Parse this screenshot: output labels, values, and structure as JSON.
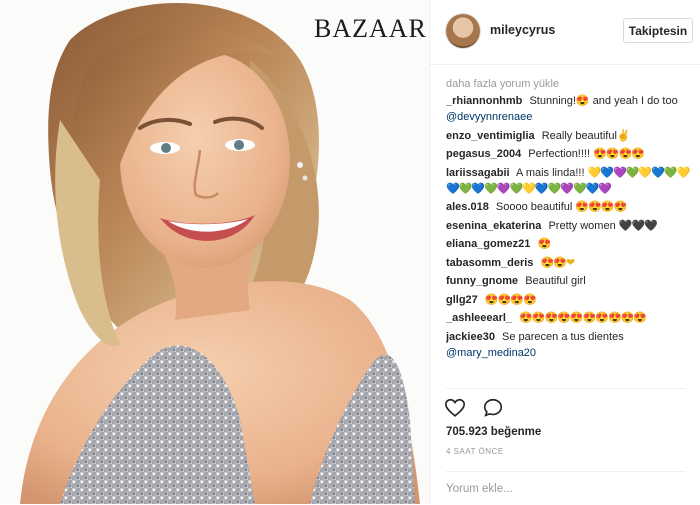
{
  "photo": {
    "brand": "BAZAAR"
  },
  "header": {
    "username": "mileycyrus",
    "follow_label": "Takiptesin"
  },
  "load_more": "daha fazla yorum yükle",
  "comments": [
    {
      "user": "_rhiannonhmb",
      "text": "Stunning!😍 and yeah I do too",
      "mention": "@devyynnrenaee"
    },
    {
      "user": "enzo_ventimiglia",
      "text": "Really beautiful✌"
    },
    {
      "user": "pegasus_2004",
      "text": "Perfection!!!!",
      "emoji": "😍😍😍😍"
    },
    {
      "user": "lariissagabii",
      "text": "A mais linda!!!",
      "emoji": "💛💙💜💚💛💙💚💛💙💚💙💚💜💚💛💙💚💜💚💙💜"
    },
    {
      "user": "ales.018",
      "text": "Soooo beautiful",
      "emoji": "😍😍😍😍"
    },
    {
      "user": "esenina_ekaterina",
      "text": "Pretty women",
      "emoji": "🖤🖤🖤"
    },
    {
      "user": "eliana_gomez21",
      "text": "",
      "emoji": "😍"
    },
    {
      "user": "tabasomm_deris",
      "text": "",
      "emoji": "😍😍❤"
    },
    {
      "user": "funny_gnome",
      "text": "Beautiful girl"
    },
    {
      "user": "gllg27",
      "text": "",
      "emoji": "😍😍😍😍"
    },
    {
      "user": "_ashleeearl_",
      "text": "",
      "emoji": "😍😍😍😍😍😍😍😍😍😍"
    },
    {
      "user": "jackiee30",
      "text": "Se parecen a tus dientes",
      "mention": "@mary_medina20"
    }
  ],
  "likes": "705.923 beğenme",
  "time": "4 SAAT ÖNCE",
  "comment_input": {
    "placeholder": "Yorum ekle...",
    "value": ""
  },
  "colors": {
    "link": "#003569",
    "muted": "#999999",
    "text": "#262626",
    "border": "#efefef"
  },
  "icons": {
    "like": "heart-icon",
    "comment": "comment-bubble-icon"
  }
}
